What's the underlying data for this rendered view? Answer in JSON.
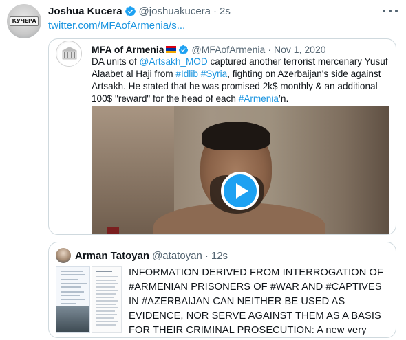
{
  "tweet": {
    "author_name": "Joshua Kucera",
    "author_handle": "@joshuakucera",
    "time": "2s",
    "avatar_label": "КУЧЕРА",
    "link": "twitter.com/MFAofArmenia/s..."
  },
  "quote": {
    "author_name": "MFA of Armenia",
    "author_handle": "@MFAofArmenia",
    "date": "Nov 1, 2020",
    "text_parts": [
      {
        "t": "DA units of ",
        "hl": false
      },
      {
        "t": "@Artsakh_MOD",
        "hl": true
      },
      {
        "t": " captured another terrorist mercenary Yusuf Alaabet al Haji from ",
        "hl": false
      },
      {
        "t": "#Idlib",
        "hl": true
      },
      {
        "t": " ",
        "hl": false
      },
      {
        "t": "#Syria",
        "hl": true
      },
      {
        "t": ", fighting on Azerbaijan's side against Artsakh. He stated that he was promised 2k$ monthly & an additional 100$ \"reward\" for the head of each ",
        "hl": false
      },
      {
        "t": "#Armenia",
        "hl": true
      },
      {
        "t": "’n.",
        "hl": false
      }
    ]
  },
  "quote2": {
    "author_name": "Arman Tatoyan",
    "author_handle": "@atatoyan",
    "time": "12s",
    "text": "INFORMATION DERIVED FROM INTERROGATION OF #ARMENIAN PRISONERS OF #WAR AND #CAPTIVES IN #AZERBAIJAN CAN NEITHER BE USED AS EVIDENCE, NOR SERVE AGAINST THEM AS A BASIS FOR THEIR CRIMINAL PROSECUTION: A new very valuable Ad Hoc ..."
  },
  "icons": {
    "verified": "verified-badge-icon",
    "more": "more-options-icon",
    "play": "play-icon",
    "flag": "armenia-flag-icon"
  },
  "colors": {
    "link": "#1b95e0",
    "verified": "#1da1f2",
    "secondary_text": "#536471",
    "border": "#cfd9de"
  }
}
